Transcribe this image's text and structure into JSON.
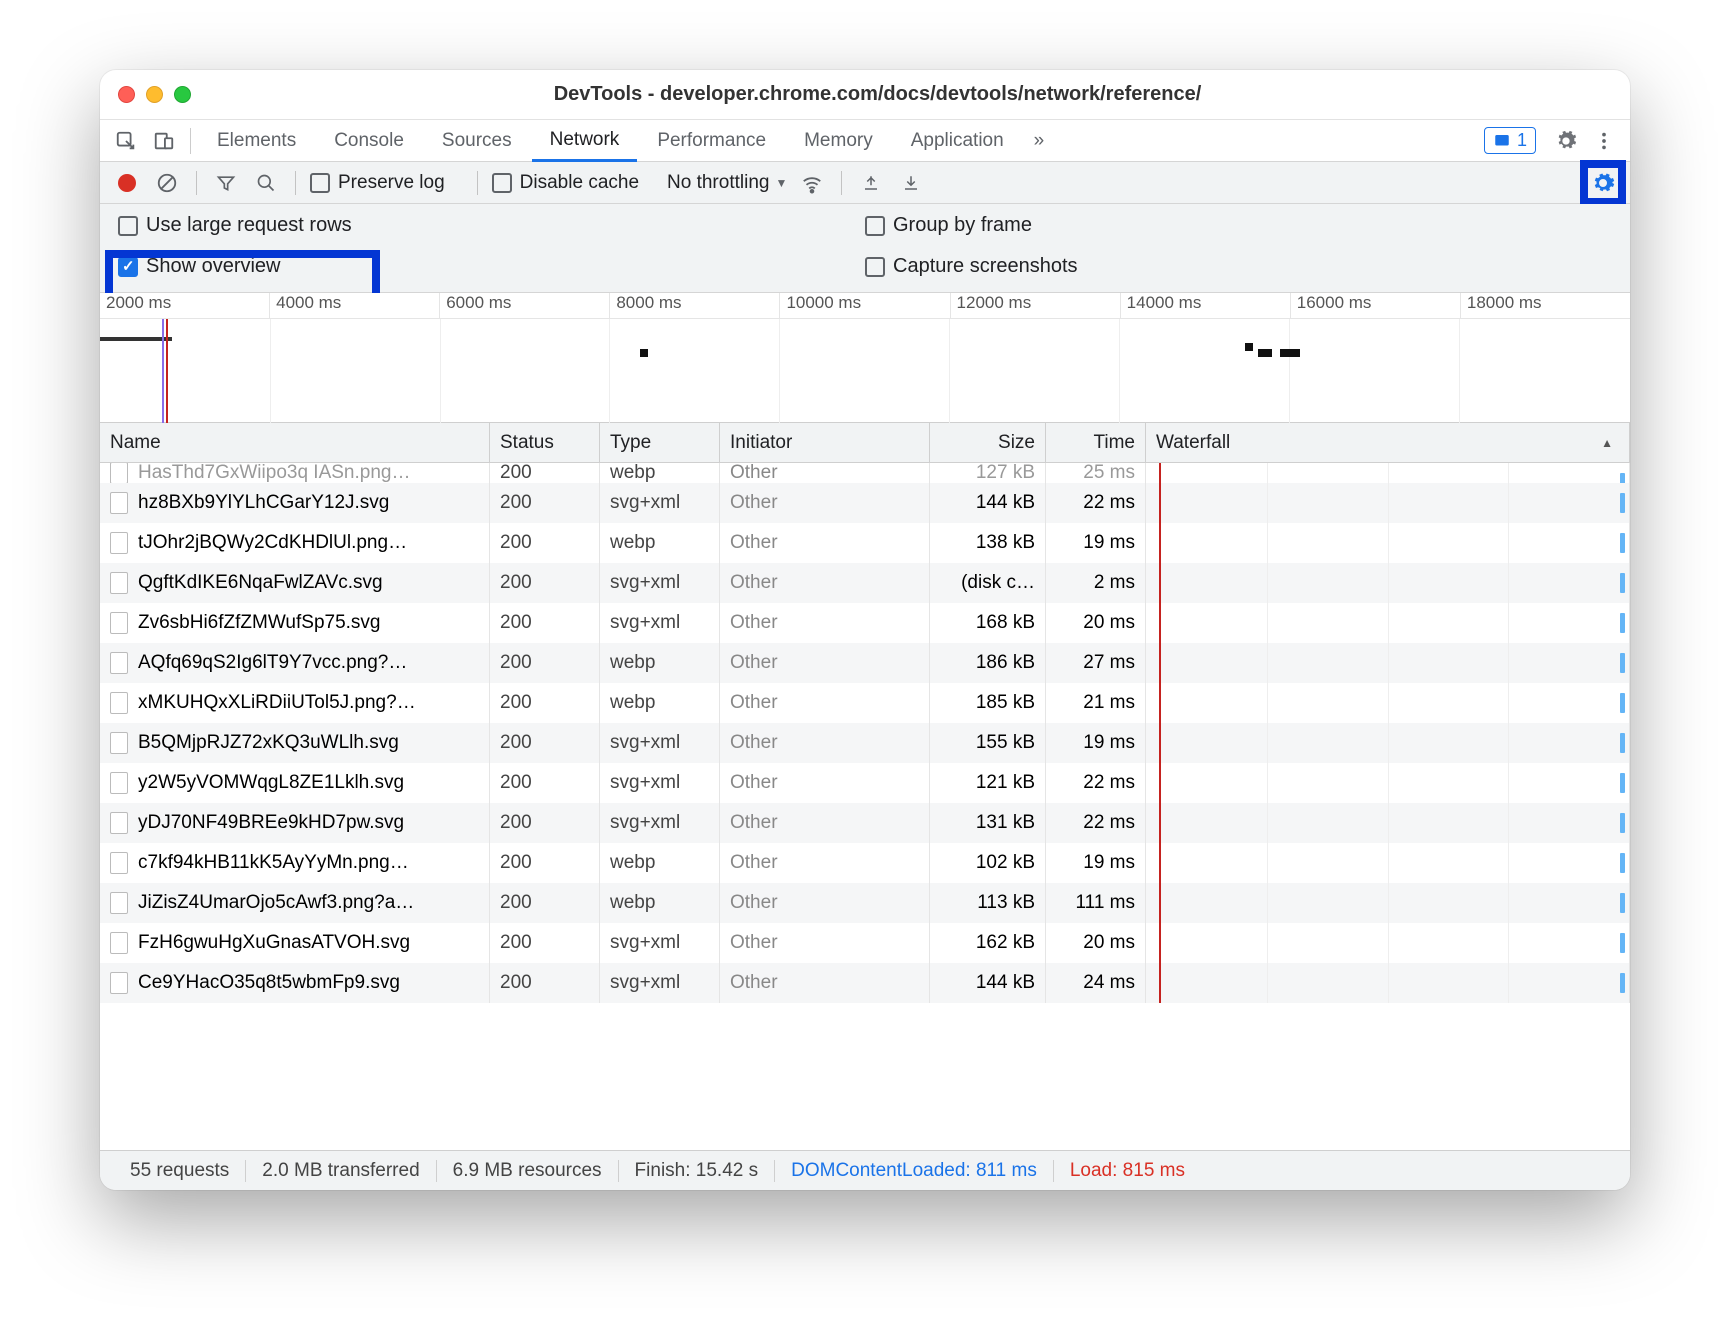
{
  "window": {
    "title": "DevTools - developer.chrome.com/docs/devtools/network/reference/"
  },
  "tabs": [
    "Elements",
    "Console",
    "Sources",
    "Network",
    "Performance",
    "Memory",
    "Application"
  ],
  "tabs_overflow_glyph": "»",
  "issues_count": "1",
  "toolbar": {
    "preserve_log": "Preserve log",
    "disable_cache": "Disable cache",
    "throttling": "No throttling"
  },
  "settings": {
    "large_rows": "Use large request rows",
    "group_by_frame": "Group by frame",
    "show_overview": "Show overview",
    "capture_screenshots": "Capture screenshots"
  },
  "ruler": [
    "2000 ms",
    "4000 ms",
    "6000 ms",
    "8000 ms",
    "10000 ms",
    "12000 ms",
    "14000 ms",
    "16000 ms",
    "18000 ms"
  ],
  "columns": {
    "name": "Name",
    "status": "Status",
    "type": "Type",
    "initiator": "Initiator",
    "size": "Size",
    "time": "Time",
    "waterfall": "Waterfall"
  },
  "clipped_row": {
    "name": "HasThd7GxWiipo3q IASn.png…",
    "status": "200",
    "type": "webp",
    "initiator": "Other",
    "size": "127 kB",
    "time": "25 ms"
  },
  "rows": [
    {
      "name": "hz8BXb9YlYLhCGarY12J.svg",
      "status": "200",
      "type": "svg+xml",
      "initiator": "Other",
      "size": "144 kB",
      "time": "22 ms"
    },
    {
      "name": "tJOhr2jBQWy2CdKHDlUl.png…",
      "status": "200",
      "type": "webp",
      "initiator": "Other",
      "size": "138 kB",
      "time": "19 ms"
    },
    {
      "name": "QgftKdIKE6NqaFwlZAVc.svg",
      "status": "200",
      "type": "svg+xml",
      "initiator": "Other",
      "size": "(disk c…",
      "time": "2 ms"
    },
    {
      "name": "Zv6sbHi6fZfZMWufSp75.svg",
      "status": "200",
      "type": "svg+xml",
      "initiator": "Other",
      "size": "168 kB",
      "time": "20 ms"
    },
    {
      "name": "AQfq69qS2Ig6lT9Y7vcc.png?…",
      "status": "200",
      "type": "webp",
      "initiator": "Other",
      "size": "186 kB",
      "time": "27 ms"
    },
    {
      "name": "xMKUHQxXLiRDiiUTol5J.png?…",
      "status": "200",
      "type": "webp",
      "initiator": "Other",
      "size": "185 kB",
      "time": "21 ms"
    },
    {
      "name": "B5QMjpRJZ72xKQ3uWLlh.svg",
      "status": "200",
      "type": "svg+xml",
      "initiator": "Other",
      "size": "155 kB",
      "time": "19 ms"
    },
    {
      "name": "y2W5yVOMWqgL8ZE1Lklh.svg",
      "status": "200",
      "type": "svg+xml",
      "initiator": "Other",
      "size": "121 kB",
      "time": "22 ms"
    },
    {
      "name": "yDJ70NF49BREe9kHD7pw.svg",
      "status": "200",
      "type": "svg+xml",
      "initiator": "Other",
      "size": "131 kB",
      "time": "22 ms"
    },
    {
      "name": "c7kf94kHB11kK5AyYyMn.png…",
      "status": "200",
      "type": "webp",
      "initiator": "Other",
      "size": "102 kB",
      "time": "19 ms"
    },
    {
      "name": "JiZisZ4UmarOjo5cAwf3.png?a…",
      "status": "200",
      "type": "webp",
      "initiator": "Other",
      "size": "113 kB",
      "time": "111 ms"
    },
    {
      "name": "FzH6gwuHgXuGnasATVOH.svg",
      "status": "200",
      "type": "svg+xml",
      "initiator": "Other",
      "size": "162 kB",
      "time": "20 ms"
    },
    {
      "name": "Ce9YHacO35q8t5wbmFp9.svg",
      "status": "200",
      "type": "svg+xml",
      "initiator": "Other",
      "size": "144 kB",
      "time": "24 ms"
    }
  ],
  "status": {
    "requests": "55 requests",
    "transferred": "2.0 MB transferred",
    "resources": "6.9 MB resources",
    "finish": "Finish: 15.42 s",
    "dcl": "DOMContentLoaded: 811 ms",
    "load": "Load: 815 ms"
  }
}
